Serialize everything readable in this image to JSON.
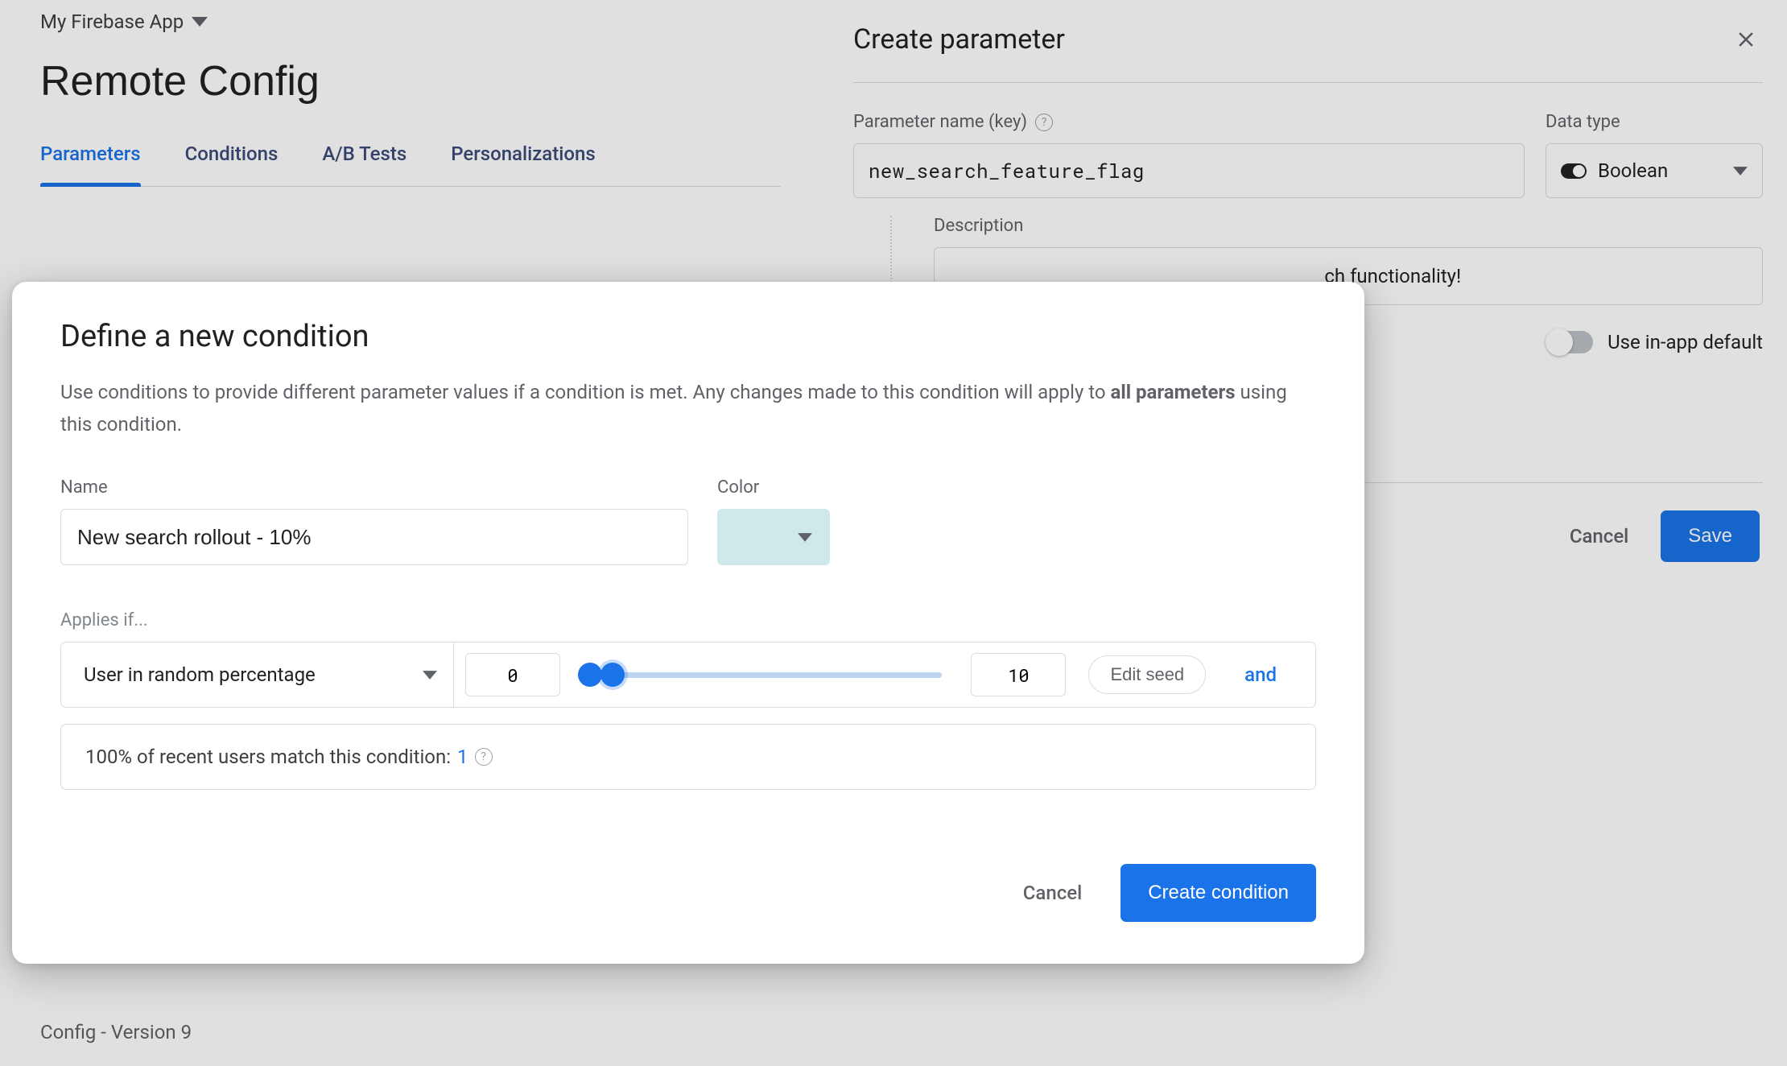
{
  "header": {
    "project_name": "My Firebase App",
    "page_title": "Remote Config",
    "tabs": [
      "Parameters",
      "Conditions",
      "A/B Tests",
      "Personalizations"
    ],
    "active_tab": "Parameters",
    "config_version": "Config - Version 9"
  },
  "right_panel": {
    "title": "Create parameter",
    "param_name_label": "Parameter name (key)",
    "param_name_value": "new_search_feature_flag",
    "datatype_label": "Data type",
    "datatype_value": "Boolean",
    "description_label": "Description",
    "description_value_suffix": "ch functionality!",
    "in_app_default_label": "Use in-app default",
    "cancel_label": "Cancel",
    "save_label": "Save"
  },
  "dialog": {
    "title": "Define a new condition",
    "desc_prefix": "Use conditions to provide different parameter values if a condition is met. Any changes made to this condition will apply to ",
    "desc_bold": "all parameters",
    "desc_suffix": " using this condition.",
    "name_label": "Name",
    "name_value": "New search rollout - 10%",
    "color_label": "Color",
    "color_value": "#cfe9ea",
    "applies_label": "Applies if...",
    "condition": {
      "type": "User in random percentage",
      "lower": "0",
      "upper": "10",
      "edit_seed_label": "Edit seed",
      "and_label": "and"
    },
    "match_text_prefix": "100% of recent users match this condition: ",
    "match_count": "1",
    "cancel_label": "Cancel",
    "create_label": "Create condition"
  }
}
